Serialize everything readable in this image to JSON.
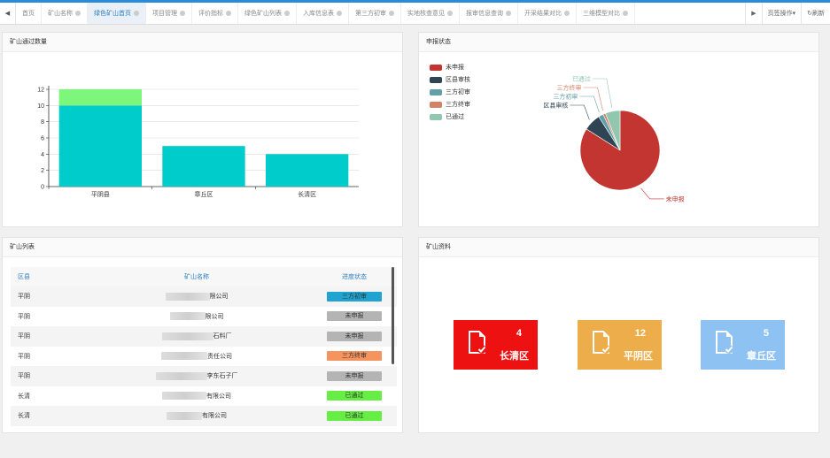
{
  "tabs": {
    "prev_icon": "double-left-arrow-icon",
    "next_icon": "double-right-arrow-icon",
    "items": [
      {
        "label": "首页",
        "closable": false,
        "active": false
      },
      {
        "label": "矿山名称",
        "closable": true,
        "active": false
      },
      {
        "label": "绿色矿山首页",
        "closable": true,
        "active": true
      },
      {
        "label": "项目管理",
        "closable": true,
        "active": false
      },
      {
        "label": "评价指标",
        "closable": true,
        "active": false
      },
      {
        "label": "绿色矿山列表",
        "closable": true,
        "active": false
      },
      {
        "label": "入库信息表",
        "closable": true,
        "active": false
      },
      {
        "label": "第三方初审",
        "closable": true,
        "active": false
      },
      {
        "label": "实地核查意见",
        "closable": true,
        "active": false
      },
      {
        "label": "报审信息查询",
        "closable": true,
        "active": false
      },
      {
        "label": "开采结果对比",
        "closable": true,
        "active": false
      },
      {
        "label": "三维模型对比",
        "closable": true,
        "active": false
      }
    ],
    "page_ops": "页签操作",
    "refresh": "刷新"
  },
  "panels": {
    "count_title": "矿山通过数量",
    "status_title": "申报状态",
    "list_title": "矿山列表",
    "info_title": "矿山资料"
  },
  "chart_data": [
    {
      "type": "bar",
      "stacked": true,
      "categories": [
        "平阴县",
        "章丘区",
        "长清区"
      ],
      "series": [
        {
          "values": [
            10,
            5,
            4
          ],
          "color": "#00cccc"
        },
        {
          "values": [
            2,
            0,
            0
          ],
          "color": "#7cf77c"
        }
      ],
      "ylim": [
        0,
        12
      ],
      "yticks": [
        0,
        2,
        4,
        6,
        8,
        10,
        12
      ],
      "grid": true
    },
    {
      "type": "pie",
      "legend_position": "top-left",
      "slices": [
        {
          "label": "未申报",
          "value": 84,
          "color": "#c23531"
        },
        {
          "label": "区县审核",
          "value": 7,
          "color": "#2f4554"
        },
        {
          "label": "三方初审",
          "value": 2,
          "color": "#61a0a8"
        },
        {
          "label": "三方终审",
          "value": 1,
          "color": "#d48265"
        },
        {
          "label": "已通过",
          "value": 6,
          "color": "#91c7ae"
        }
      ]
    }
  ],
  "table": {
    "headers": [
      "区县",
      "矿山名称",
      "进度状态"
    ],
    "rows": [
      {
        "district": "平阴",
        "name_suffix": "限公司",
        "status": "三方初审",
        "color": "#1fa3d0"
      },
      {
        "district": "平阴",
        "name_suffix": "限公司",
        "status": "未申报",
        "color": "#b4b4b4"
      },
      {
        "district": "平阴",
        "name_suffix": "石料厂",
        "status": "未申报",
        "color": "#b4b4b4"
      },
      {
        "district": "平阴",
        "name_suffix": "责任公司",
        "status": "三方终审",
        "color": "#f5955d"
      },
      {
        "district": "平阴",
        "name_suffix": "李东石子厂",
        "status": "未申报",
        "color": "#b4b4b4"
      },
      {
        "district": "长清",
        "name_suffix": "有限公司",
        "status": "已通过",
        "color": "#66ee44"
      },
      {
        "district": "长清",
        "name_suffix": "有限公司",
        "status": "已通过",
        "color": "#66ee44"
      }
    ]
  },
  "cards": [
    {
      "count": "4",
      "name": "长清区",
      "color": "#ee1111",
      "icon": "document-check-icon"
    },
    {
      "count": "12",
      "name": "平阴区",
      "color": "#ecad4a",
      "icon": "document-check-icon"
    },
    {
      "count": "5",
      "name": "章丘区",
      "color": "#8ec2f2",
      "icon": "document-check-icon"
    }
  ]
}
